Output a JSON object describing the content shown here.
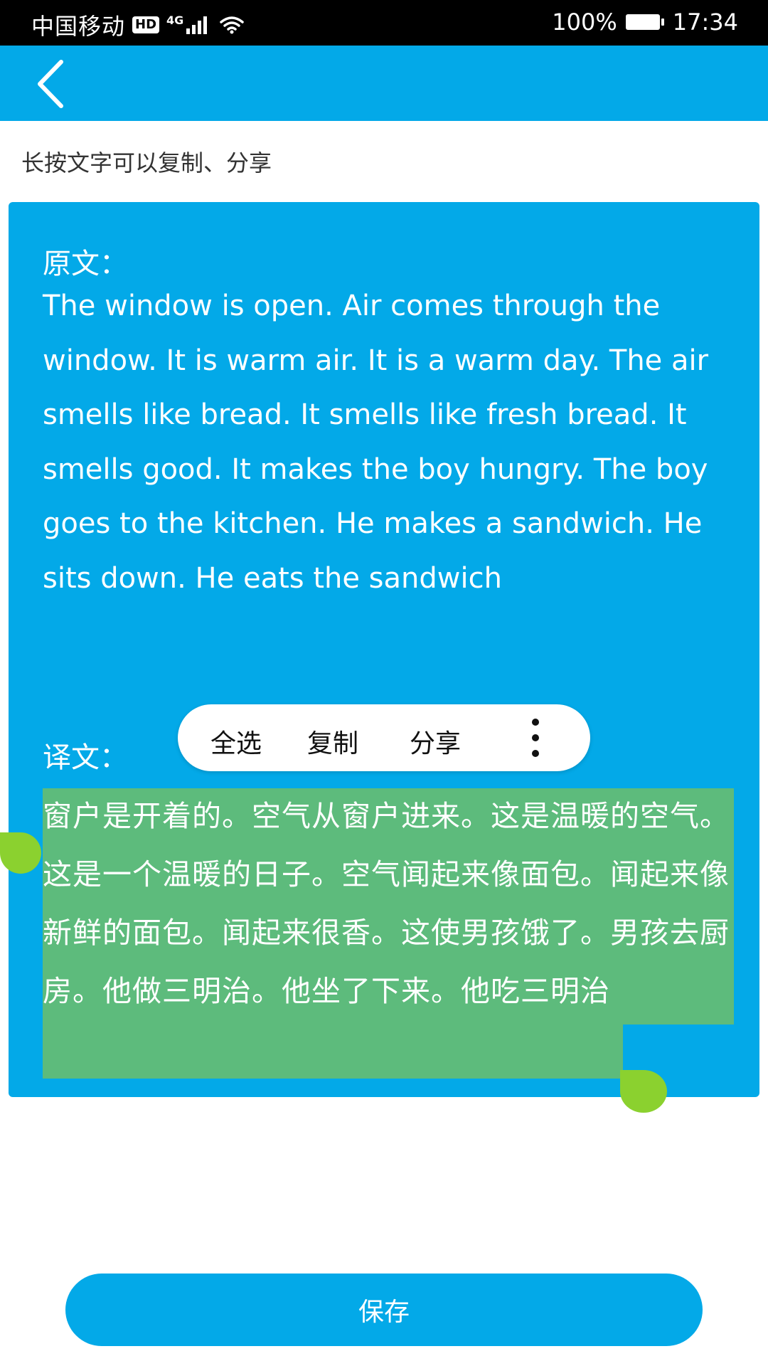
{
  "status_bar": {
    "carrier": "中国移动",
    "hd_badge": "HD",
    "network_type": "4G",
    "battery": "100%",
    "time": "17:34"
  },
  "header": {
    "back_icon": "chevron-left-icon"
  },
  "hint": "长按文字可以复制、分享",
  "card": {
    "original_label": "原文：",
    "original_text": "The window is open. Air comes through the window. It is warm air. It is a warm day. The air smells like bread. It smells like fresh bread. It smells good. It makes the boy hungry. The boy goes to the kitchen. He makes a sandwich. He sits down. He eats the sandwich",
    "translation_label": "译文：",
    "translation_text": "窗户是开着的。空气从窗户进来。这是温暖的空气。这是一个温暖的日子。空气闻起来像面包。闻起来像新鲜的面包。闻起来很香。这使男孩饿了。男孩去厨房。他做三明治。他坐了下来。他吃三明治"
  },
  "context_menu": {
    "select_all": "全选",
    "copy": "复制",
    "share": "分享",
    "more_icon": "more-vertical-icon"
  },
  "save_label": "保存",
  "colors": {
    "accent": "#03a9e8",
    "selection": "#5dbb7c",
    "handle": "#8bd12f"
  }
}
